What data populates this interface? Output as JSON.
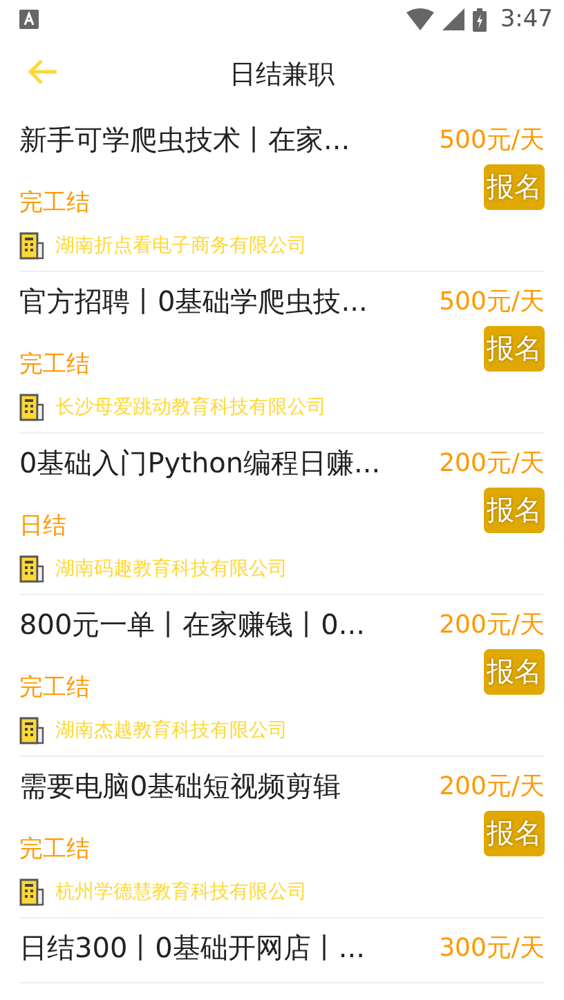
{
  "status_bar": {
    "time": "3:47"
  },
  "header": {
    "title": "日结兼职"
  },
  "jobs": [
    {
      "title": "新手可学爬虫技术丨在家...",
      "salary": "500元/天",
      "settlement": "完工结",
      "action": "报名",
      "company": "湖南折点看电子商务有限公司"
    },
    {
      "title": "官方招聘丨0基础学爬虫技...",
      "salary": "500元/天",
      "settlement": "完工结",
      "action": "报名",
      "company": "长沙母爱跳动教育科技有限公司"
    },
    {
      "title": "0基础入门Python编程日赚...",
      "salary": "200元/天",
      "settlement": "日结",
      "action": "报名",
      "company": "湖南码趣教育科技有限公司"
    },
    {
      "title": "800元一单丨在家赚钱丨0...",
      "salary": "200元/天",
      "settlement": "完工结",
      "action": "报名",
      "company": "湖南杰越教育科技有限公司"
    },
    {
      "title": "需要电脑0基础短视频剪辑",
      "salary": "200元/天",
      "settlement": "完工结",
      "action": "报名",
      "company": "杭州学德慧教育科技有限公司"
    },
    {
      "title": "日结300丨0基础开网店丨...",
      "salary": "300元/天"
    }
  ]
}
